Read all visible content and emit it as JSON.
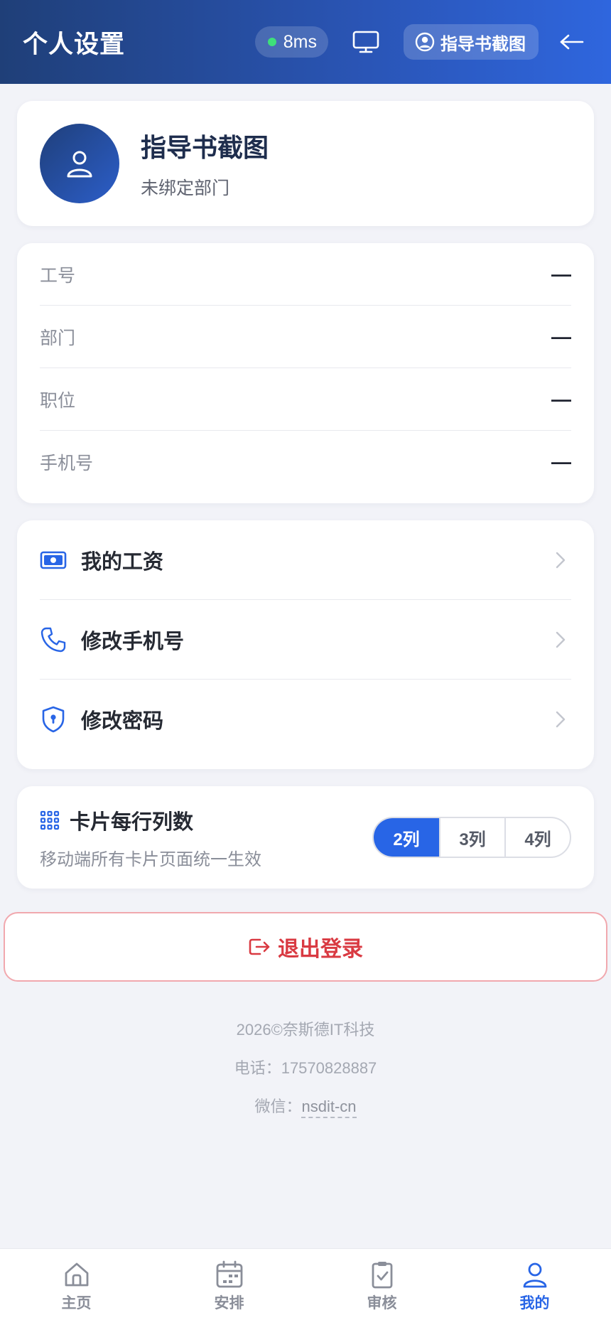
{
  "header": {
    "title": "个人设置",
    "latency": "8ms",
    "monitor_icon": "monitor-icon",
    "user_name": "指导书截图",
    "back_icon": "arrow-left-icon"
  },
  "profile": {
    "name": "指导书截图",
    "department": "未绑定部门"
  },
  "info": [
    {
      "label": "工号",
      "value": "—"
    },
    {
      "label": "部门",
      "value": "—"
    },
    {
      "label": "职位",
      "value": "—"
    },
    {
      "label": "手机号",
      "value": "—"
    }
  ],
  "menu": [
    {
      "label": "我的工资",
      "icon": "money-icon"
    },
    {
      "label": "修改手机号",
      "icon": "phone-icon"
    },
    {
      "label": "修改密码",
      "icon": "shield-lock-icon"
    }
  ],
  "columns_setting": {
    "title": "卡片每行列数",
    "description": "移动端所有卡片页面统一生效",
    "options": [
      "2列",
      "3列",
      "4列"
    ],
    "selected": "2列"
  },
  "logout": {
    "label": "退出登录"
  },
  "footer": {
    "copyright": "2026©奈斯德IT科技",
    "phone": "电话：17570828887",
    "wechat_label": "微信：",
    "wechat_id": "nsdit-cn"
  },
  "tabbar": [
    {
      "label": "主页",
      "icon": "home-icon"
    },
    {
      "label": "安排",
      "icon": "calendar-icon"
    },
    {
      "label": "审核",
      "icon": "clipboard-check-icon"
    },
    {
      "label": "我的",
      "icon": "user-icon",
      "active": true
    }
  ],
  "colors": {
    "accent": "#2865e6",
    "danger": "#d93a42",
    "header_start": "#1f3f78",
    "header_end": "#2f66de"
  }
}
